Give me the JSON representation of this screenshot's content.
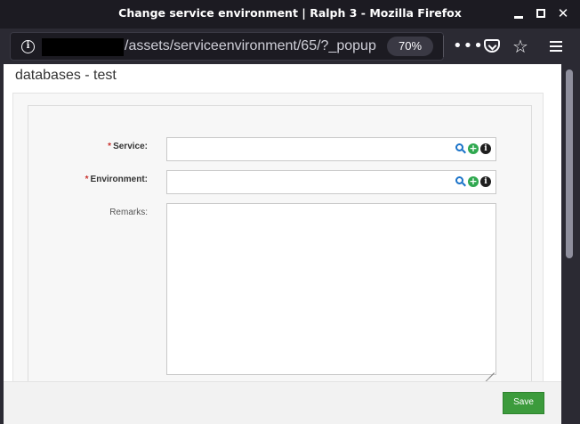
{
  "window": {
    "title": "Change service environment | Ralph 3 - Mozilla Firefox",
    "minimize_label": "",
    "close_glyph": "✕"
  },
  "navbar": {
    "url": "/assets/serviceenvironment/65/?_popup",
    "zoom": "70%",
    "more_glyph": "•••",
    "star_glyph": "☆"
  },
  "page": {
    "heading": "databases - test"
  },
  "form": {
    "required_mark": "*",
    "service_label": "Service:",
    "environment_label": "Environment:",
    "remarks_label": "Remarks:",
    "service_value": "",
    "environment_value": "",
    "remarks_value": "",
    "add_glyph": "+",
    "info_glyph": "i"
  },
  "footer": {
    "save_label": "Save"
  },
  "colors": {
    "title_bar": "#1c1b22",
    "toolbar": "#2b2a33",
    "save_button": "#3c9b3c",
    "search_icon": "#1a73c9",
    "add_icon": "#2fa84f",
    "required": "#c9302c"
  },
  "icons": [
    "info-icon",
    "more-icon",
    "pocket-icon",
    "star-icon",
    "menu-icon",
    "search-icon",
    "add-icon",
    "details-icon",
    "resize-handle-icon"
  ]
}
